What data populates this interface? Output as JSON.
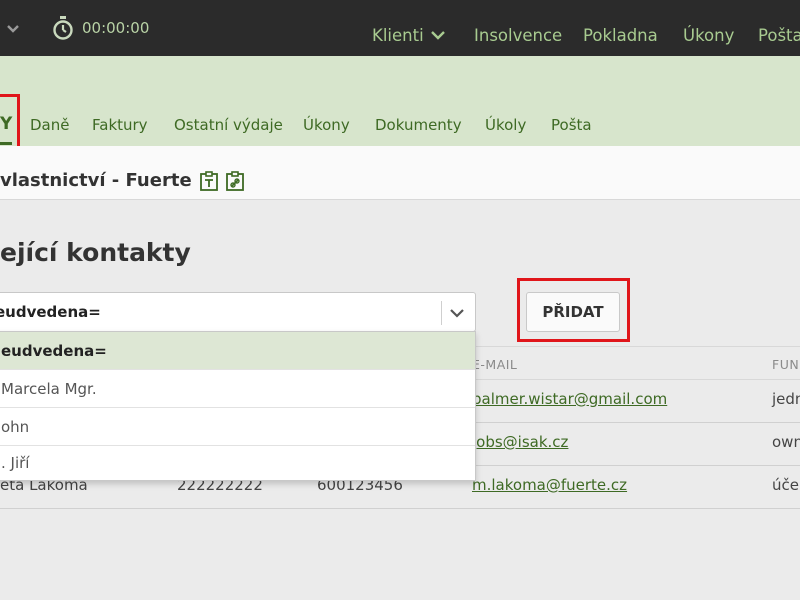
{
  "topbar": {
    "timer": "00:00:00",
    "nav": [
      {
        "label": "Klienti",
        "has_dropdown": true
      },
      {
        "label": "Insolvence"
      },
      {
        "label": "Pokladna"
      },
      {
        "label": "Úkony"
      },
      {
        "label": "Pošta"
      }
    ]
  },
  "tabs": {
    "active_partial": "Y",
    "items": [
      "Daně",
      "Faktury",
      "Ostatní výdaje",
      "Úkony",
      "Dokumenty",
      "Úkoly",
      "Pošta"
    ]
  },
  "page": {
    "title": "vlastnictví - Fuerte",
    "section_title": "ející kontakty"
  },
  "contact_select": {
    "value": "eudvedena=",
    "options": [
      "eudvedena=",
      "Marcela Mgr.",
      "ohn",
      ". Jiří"
    ]
  },
  "add_button": {
    "label": "PŘIDAT"
  },
  "table": {
    "headers": {
      "email": "E-MAIL",
      "function": "FUN"
    },
    "rows": [
      {
        "email": "palmer.wistar@gmail.com",
        "function": "jedn"
      },
      {
        "email": "jobs@isak.cz",
        "function": "own"
      },
      {
        "name": "eta Lakoma",
        "phone1": "222222222",
        "phone2": "600123456",
        "email": "m.lakoma@fuerte.cz",
        "function": "úče"
      }
    ]
  },
  "colors": {
    "topbar_bg": "#2b2b2b",
    "accent_green": "#3e6a24",
    "header_green": "#d7e5cc",
    "highlight_red": "#e0151a"
  }
}
